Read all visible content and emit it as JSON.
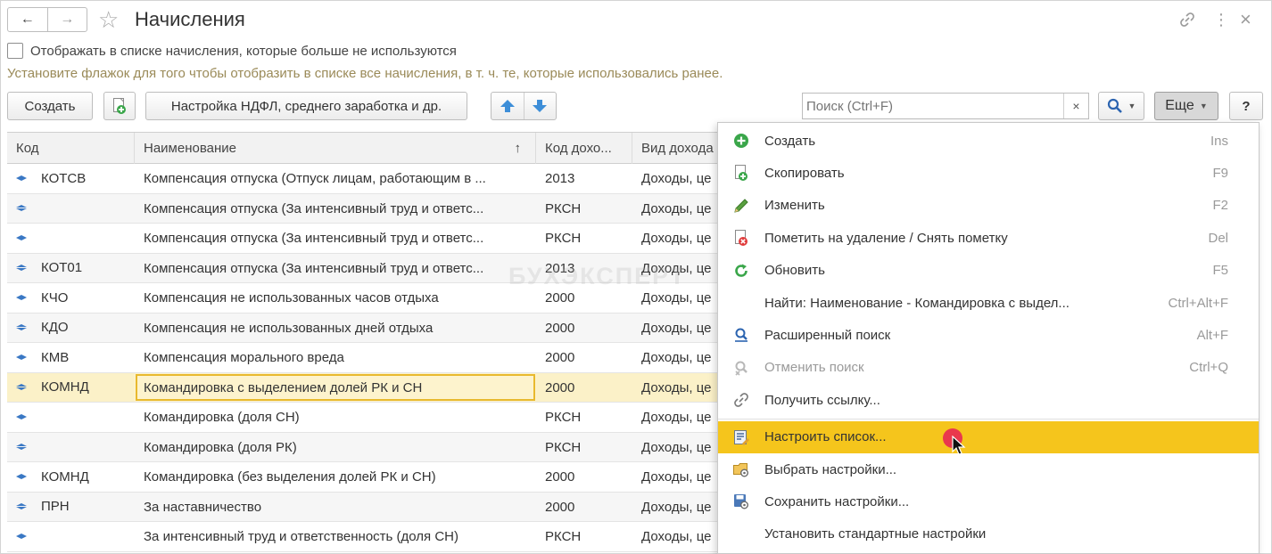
{
  "window": {
    "title": "Начисления",
    "back_icon": "←",
    "forward_icon": "→",
    "link_icon": "link-icon",
    "more_icon": "⋮",
    "close_icon": "×"
  },
  "filter": {
    "checkbox_label": "Отображать в списке начисления, которые больше не используются",
    "checked": false,
    "hint": "Установите флажок для того чтобы отобразить в списке все начисления, в т. ч. те, которые использовались ранее."
  },
  "toolbar": {
    "create_label": "Создать",
    "ndfl_label": "Настройка НДФЛ, среднего заработка и др.",
    "search_placeholder": "Поиск (Ctrl+F)",
    "search_clear": "×",
    "more_label": "Еще",
    "help_label": "?"
  },
  "table": {
    "headers": [
      "Код",
      "Наименование",
      "Код дохо...",
      "Вид дохода"
    ],
    "sort_indicator": "↑",
    "rows": [
      {
        "code": "КОТСВ",
        "name": "Компенсация отпуска (Отпуск лицам, работающим в ...",
        "income_code": "2013",
        "income_type": "Доходы, це"
      },
      {
        "code": "",
        "name": "Компенсация отпуска (За интенсивный труд и ответс...",
        "income_code": "РКСН",
        "income_type": "Доходы, це"
      },
      {
        "code": "",
        "name": "Компенсация отпуска (За интенсивный труд и ответс...",
        "income_code": "РКСН",
        "income_type": "Доходы, це"
      },
      {
        "code": "КОТ01",
        "name": "Компенсация отпуска (За интенсивный труд и ответс...",
        "income_code": "2013",
        "income_type": "Доходы, це"
      },
      {
        "code": "КЧО",
        "name": "Компенсация не использованных часов отдыха",
        "income_code": "2000",
        "income_type": "Доходы, це"
      },
      {
        "code": "КДО",
        "name": "Компенсация не использованных дней отдыха",
        "income_code": "2000",
        "income_type": "Доходы, це"
      },
      {
        "code": "КМВ",
        "name": "Компенсация морального вреда",
        "income_code": "2000",
        "income_type": "Доходы, це"
      },
      {
        "code": "КОМНД",
        "name": "Командировка с выделением долей РК и СН",
        "income_code": "2000",
        "income_type": "Доходы, це"
      },
      {
        "code": "",
        "name": "Командировка (доля СН)",
        "income_code": "РКСН",
        "income_type": "Доходы, це"
      },
      {
        "code": "",
        "name": "Командировка (доля РК)",
        "income_code": "РКСН",
        "income_type": "Доходы, це"
      },
      {
        "code": "КОМНД",
        "name": "Командировка (без выделения долей РК и СН)",
        "income_code": "2000",
        "income_type": "Доходы, це"
      },
      {
        "code": "ПРН",
        "name": "За наставничество",
        "income_code": "2000",
        "income_type": "Доходы, це"
      },
      {
        "code": "",
        "name": "За интенсивный труд и ответственность (доля СН)",
        "income_code": "РКСН",
        "income_type": "Доходы, це"
      }
    ],
    "selected_row_index": 7
  },
  "watermark": "БУХЭКСПЕРТ",
  "menu": {
    "items": [
      {
        "label": "Создать",
        "shortcut": "Ins",
        "icon": "add-circle-icon"
      },
      {
        "label": "Скопировать",
        "shortcut": "F9",
        "icon": "copy-icon"
      },
      {
        "label": "Изменить",
        "shortcut": "F2",
        "icon": "pencil-icon"
      },
      {
        "label": "Пометить на удаление / Снять пометку",
        "shortcut": "Del",
        "icon": "mark-delete-icon"
      },
      {
        "label": "Обновить",
        "shortcut": "F5",
        "icon": "refresh-icon"
      },
      {
        "label": "Найти: Наименование - Командировка с выдел...",
        "shortcut": "Ctrl+Alt+F",
        "icon": ""
      },
      {
        "label": "Расширенный поиск",
        "shortcut": "Alt+F",
        "icon": "advanced-search-icon"
      },
      {
        "label": "Отменить поиск",
        "shortcut": "Ctrl+Q",
        "icon": "cancel-search-icon",
        "disabled": true
      },
      {
        "label": "Получить ссылку...",
        "shortcut": "",
        "icon": "link-icon"
      },
      {
        "label": "Настроить список...",
        "shortcut": "",
        "icon": "list-settings-icon",
        "highlighted": true
      },
      {
        "label": "Выбрать настройки...",
        "shortcut": "",
        "icon": "choose-settings-icon"
      },
      {
        "label": "Сохранить настройки...",
        "shortcut": "",
        "icon": "save-settings-icon"
      },
      {
        "label": "Установить стандартные настройки",
        "shortcut": "",
        "icon": ""
      }
    ]
  },
  "colors": {
    "accent_yellow": "#f5c51c",
    "selected_row": "#fbf1c8",
    "hint_text": "#9a8a58",
    "arrow_blue": "#3a78c4",
    "green": "#3aa64a"
  }
}
